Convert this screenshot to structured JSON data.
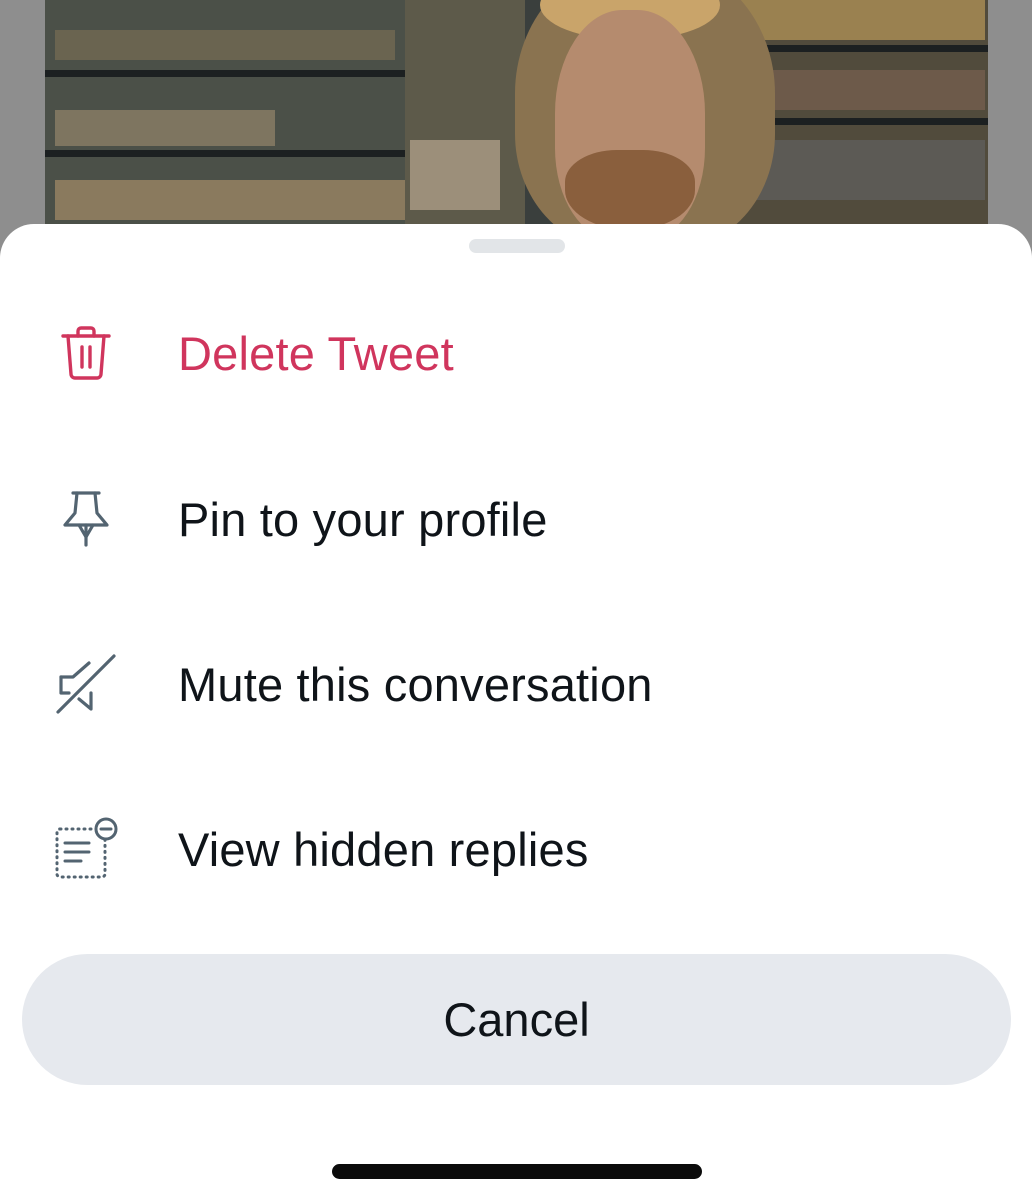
{
  "background": {
    "media_description_icon": "tweet-photo"
  },
  "sheet": {
    "items": [
      {
        "id": "delete",
        "label": "Delete Tweet",
        "icon": "trash-icon",
        "color": "#d0355d"
      },
      {
        "id": "pin",
        "label": "Pin to your profile",
        "icon": "pin-icon",
        "color": "#536471"
      },
      {
        "id": "mute",
        "label": "Mute this conversation",
        "icon": "muted-speaker-icon",
        "color": "#536471"
      },
      {
        "id": "hidden",
        "label": "View hidden replies",
        "icon": "hidden-replies-icon",
        "color": "#536471"
      }
    ],
    "cancel_label": "Cancel"
  },
  "colors": {
    "danger": "#d0355d",
    "text": "#0f1419",
    "icon": "#536471",
    "cancel_bg": "#e6e9ee",
    "sheet_bg": "#ffffff"
  }
}
